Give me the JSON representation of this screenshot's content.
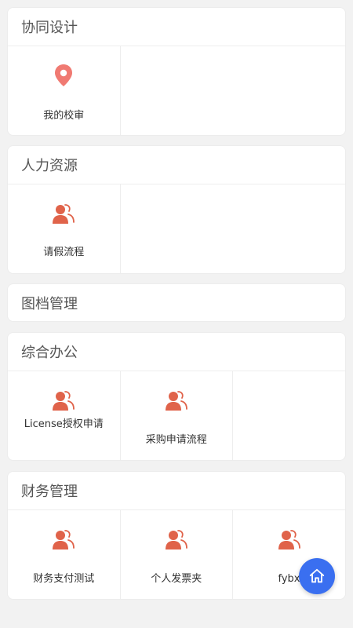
{
  "colors": {
    "accent_icon": "#e0634a",
    "location_icon": "#f07a72",
    "fab": "#3a6ff0",
    "background": "#f2f2f2"
  },
  "sections": [
    {
      "title": "协同设计",
      "items": [
        {
          "label": "我的校审",
          "icon": "location-pin-icon"
        }
      ]
    },
    {
      "title": "人力资源",
      "items": [
        {
          "label": "请假流程",
          "icon": "people-icon"
        }
      ]
    },
    {
      "title": "图档管理",
      "items": []
    },
    {
      "title": "综合办公",
      "items": [
        {
          "label": "License授权申请",
          "icon": "people-icon"
        },
        {
          "label": "采购申请流程",
          "icon": "people-icon"
        }
      ]
    },
    {
      "title": "财务管理",
      "items": [
        {
          "label": "财务支付测试",
          "icon": "people-icon"
        },
        {
          "label": "个人发票夹",
          "icon": "people-icon"
        },
        {
          "label": "fybx",
          "icon": "people-icon"
        }
      ]
    }
  ],
  "fab": {
    "icon": "home-icon"
  }
}
